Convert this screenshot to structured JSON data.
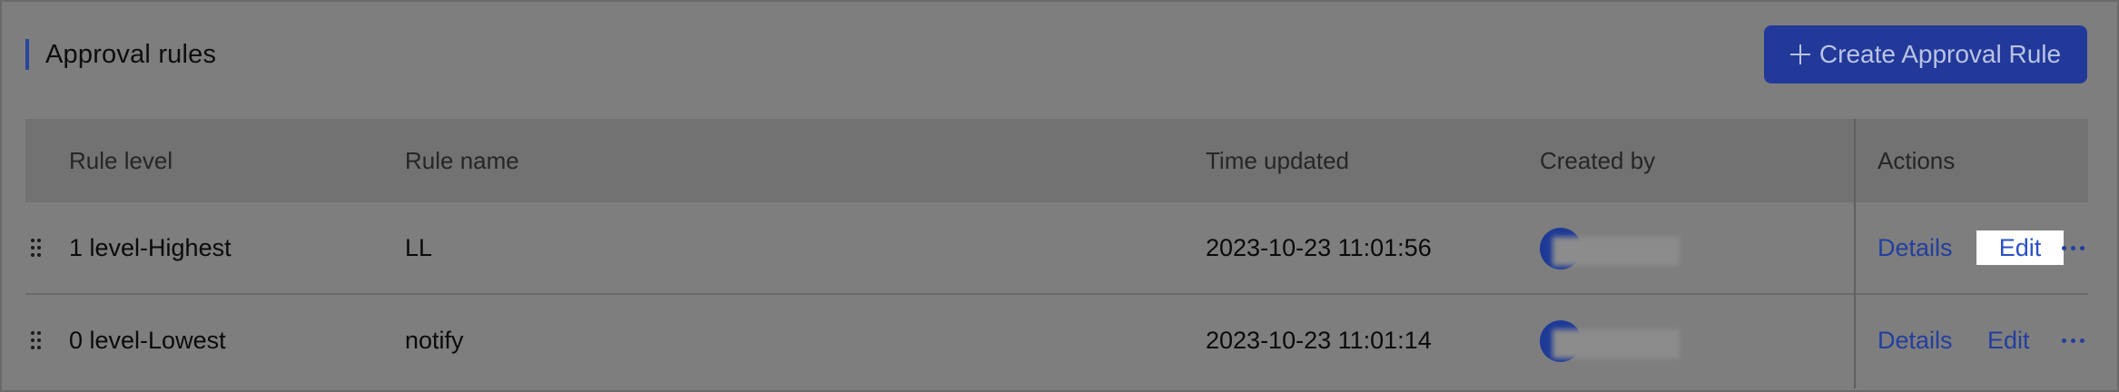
{
  "section": {
    "title": "Approval rules"
  },
  "toolbar": {
    "create_label": "Create Approval Rule"
  },
  "table": {
    "headers": {
      "rule_level": "Rule level",
      "rule_name": "Rule name",
      "time_updated": "Time updated",
      "created_by": "Created by",
      "actions": "Actions"
    },
    "rows": [
      {
        "rule_level": "1 level-Highest",
        "rule_name": "LL",
        "time_updated": "2023-10-23 11:01:56",
        "details_label": "Details",
        "edit_label": "Edit"
      },
      {
        "rule_level": "0 level-Lowest",
        "rule_name": "notify",
        "time_updated": "2023-10-23 11:01:14",
        "details_label": "Details",
        "edit_label": "Edit"
      }
    ]
  },
  "colors": {
    "accent": "#22399a",
    "link": "#233e9e",
    "highlight": "#ffffff"
  },
  "icons": {
    "create": "plus-icon",
    "drag": "drag-handle-icon",
    "more": "more-horizontal-icon"
  }
}
